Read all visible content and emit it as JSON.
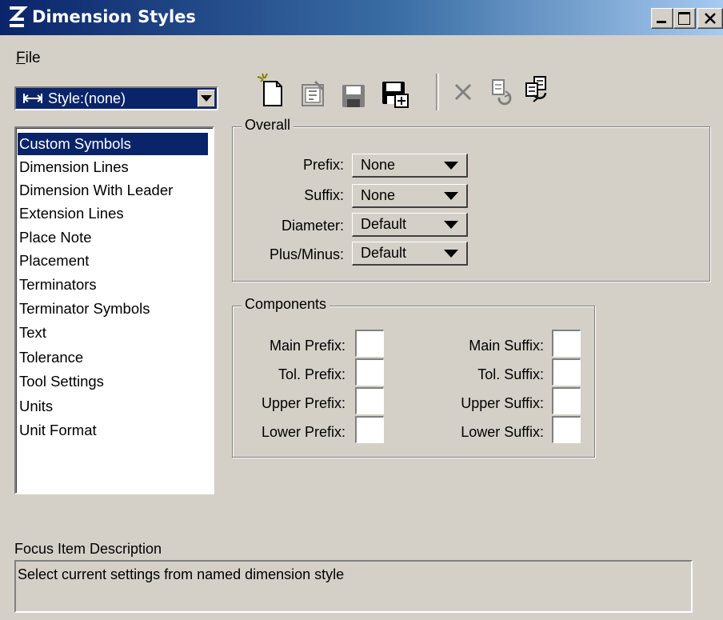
{
  "window": {
    "title": "Dimension Styles"
  },
  "menu": {
    "file": "File"
  },
  "style_selector": {
    "value": "Style:(none)"
  },
  "toolbar": {
    "icons": [
      "new-style-icon",
      "properties-icon",
      "save-icon",
      "save-as-icon",
      "delete-icon",
      "reset-icon",
      "copy-style-icon"
    ]
  },
  "category_list": {
    "items": [
      "Custom Symbols",
      "Dimension Lines",
      "Dimension With Leader",
      "Extension Lines",
      "Place Note",
      "Placement",
      "Terminators",
      "Terminator Symbols",
      "Text",
      "Tolerance",
      "Tool Settings",
      "Units",
      "Unit Format"
    ],
    "selected": "Custom Symbols"
  },
  "overall": {
    "title": "Overall",
    "prefix_label": "Prefix:",
    "prefix_value": "None",
    "suffix_label": "Suffix:",
    "suffix_value": "None",
    "diameter_label": "Diameter:",
    "diameter_value": "Default",
    "plusminus_label": "Plus/Minus:",
    "plusminus_value": "Default"
  },
  "components": {
    "title": "Components",
    "main_prefix": "Main Prefix:",
    "tol_prefix": "Tol. Prefix:",
    "upper_prefix": "Upper Prefix:",
    "lower_prefix": "Lower Prefix:",
    "main_suffix": "Main Suffix:",
    "tol_suffix": "Tol. Suffix:",
    "upper_suffix": "Upper Suffix:",
    "lower_suffix": "Lower Suffix:"
  },
  "focus": {
    "label": "Focus Item Description",
    "text": "Select current settings from named dimension style"
  },
  "colors": {
    "title_bar": "#0a246a",
    "face": "#d4d0c8",
    "selection": "#0a246a"
  }
}
